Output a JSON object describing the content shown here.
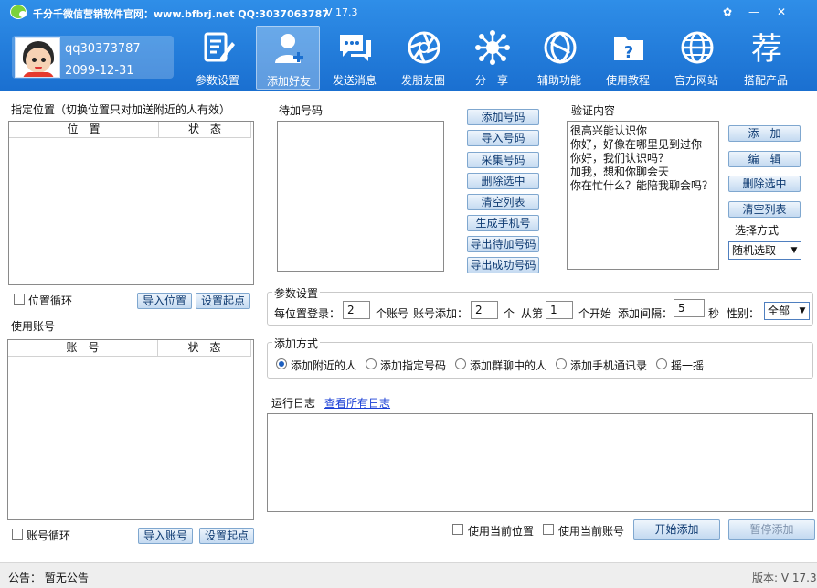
{
  "titlebar": {
    "title": "千分千微信营销软件官网：www.bfbrj.net QQ:3037063787",
    "version": "V 17.3",
    "controls": [
      "✿",
      "—",
      "✕"
    ]
  },
  "profile": {
    "username": "qq30373787",
    "expiry": "2099-12-31"
  },
  "nav": [
    {
      "label": "参数设置",
      "icon": "document-edit-icon"
    },
    {
      "label": "添加好友",
      "icon": "add-user-icon"
    },
    {
      "label": "发送消息",
      "icon": "chat-bubbles-icon"
    },
    {
      "label": "发朋友圈",
      "icon": "camera-aperture-icon"
    },
    {
      "label": "分　享",
      "icon": "share-network-icon"
    },
    {
      "label": "辅助功能",
      "icon": "helper-swirl-icon"
    },
    {
      "label": "使用教程",
      "icon": "tutorial-folder-icon"
    },
    {
      "label": "官方网站",
      "icon": "globe-icon"
    },
    {
      "label": "搭配产品",
      "icon": "recommend-glyph-icon",
      "glyph": "荐"
    }
  ],
  "location": {
    "title": "指定位置（切换位置只对加送附近的人有效）",
    "headers": [
      "位　置",
      "状　态"
    ],
    "loop_label": "位置循环",
    "import_label": "导入位置",
    "set_start_label": "设置起点"
  },
  "accounts": {
    "title": "使用账号",
    "headers": [
      "账　号",
      "状　态"
    ],
    "loop_label": "账号循环",
    "import_label": "导入账号",
    "set_start_label": "设置起点"
  },
  "pending": {
    "title": "待加号码",
    "buttons": [
      "添加号码",
      "导入号码",
      "采集号码",
      "删除选中",
      "清空列表",
      "生成手机号",
      "导出待加号码",
      "导出成功号码"
    ]
  },
  "verify": {
    "title": "验证内容",
    "lines": [
      "很高兴能认识你",
      "你好，好像在哪里见到过你",
      "你好，我们认识吗？",
      "加我，想和你聊会天",
      "你在忙什么？能陪我聊会吗？"
    ],
    "buttons": [
      "添　加",
      "编　辑",
      "删除选中",
      "清空列表"
    ],
    "mode_label": "选择方式",
    "mode_value": "随机选取"
  },
  "params": {
    "title": "参数设置",
    "per_location_label": "每位置登录：",
    "per_location_value": "2",
    "accounts_unit": "个账号",
    "per_account_label": "账号添加：",
    "per_account_value": "2",
    "count_unit": "个",
    "from_label": "从第",
    "from_value": "1",
    "start_unit": "个开始",
    "interval_label": "添加间隔：",
    "interval_value": "5",
    "seconds_unit": "秒",
    "gender_label": "性别：",
    "gender_value": "全部"
  },
  "method": {
    "title": "添加方式",
    "options": [
      "添加附近的人",
      "添加指定号码",
      "添加群聊中的人",
      "添加手机通讯录",
      "摇一摇"
    ],
    "selected": 0
  },
  "log": {
    "title": "运行日志",
    "view_all": "查看所有日志"
  },
  "actions": {
    "use_location": "使用当前位置",
    "use_account": "使用当前账号",
    "start": "开始添加",
    "pause": "暂停添加"
  },
  "status": {
    "notice": "公告：  暂无公告",
    "version": "版本: V 17.3"
  },
  "colors": {
    "header": "#2f8ee8",
    "button": "#c4daf1",
    "accent_logo": "#7bd23a"
  }
}
